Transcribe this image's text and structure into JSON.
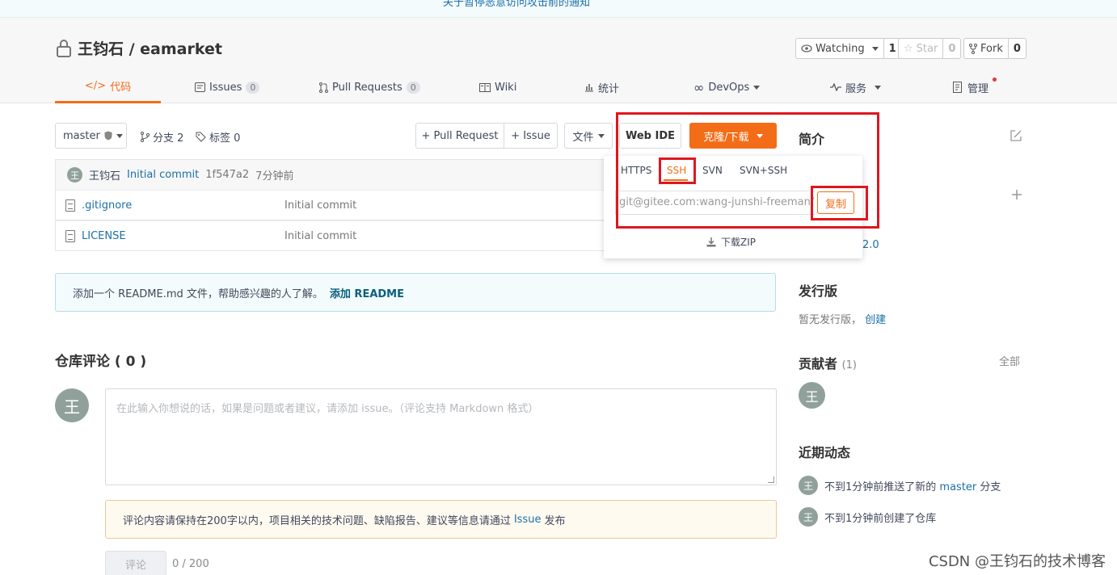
{
  "notice": "关于暂停恶意访问攻击前的通知",
  "repo": {
    "title": "王钧石 / eamarket"
  },
  "social": {
    "watch_label": "Watching",
    "watch_count": "1",
    "star_label": "Star",
    "star_count": "0",
    "fork_label": "Fork",
    "fork_count": "0"
  },
  "tabs": {
    "code": "代码",
    "issues": "Issues",
    "issues_count": "0",
    "pulls": "Pull Requests",
    "pulls_count": "0",
    "wiki": "Wiki",
    "stats": "统计",
    "devops": "DevOps",
    "services": "服务",
    "admin": "管理"
  },
  "toolbar": {
    "branch": "master",
    "branches": "分支 2",
    "tags": "标签 0",
    "pull_request": "+ Pull Request",
    "issue": "+ Issue",
    "file": "文件",
    "web_ide": "Web IDE",
    "clone": "克隆/下载"
  },
  "commit": {
    "author": "王钧石",
    "message": "Initial commit",
    "hash": "1f547a2",
    "time": "7分钟前",
    "avatar_letter": "王"
  },
  "files": [
    {
      "name": ".gitignore",
      "message": "Initial commit"
    },
    {
      "name": "LICENSE",
      "message": "Initial commit"
    }
  ],
  "readme_tip": {
    "text": "添加一个 README.md 文件，帮助感兴趣的人了解。",
    "link": "添加 README"
  },
  "comments": {
    "title": "仓库评论 ( 0 )",
    "avatar_letter": "王",
    "placeholder": "在此输入你想说的话，如果是问题或者建议，请添加 issue。（评论支持 Markdown 格式）",
    "warn_text": "评论内容请保持在200字以内，项目相关的技术问题、缺陷报告、建议等信息请通过",
    "warn_link": "Issue",
    "warn_suffix": "发布",
    "submit": "评论",
    "counter": "0 / 200"
  },
  "clone_menu": {
    "tabs": [
      "HTTPS",
      "SSH",
      "SVN",
      "SVN+SSH"
    ],
    "active": "SSH",
    "url": "git@gitee.com:wang-junshi-freeman/eamarket.git",
    "copy": "复制",
    "download_zip": "下载ZIP"
  },
  "sidebar": {
    "intro": "简介",
    "license_suffix": "2.0",
    "releases_title": "发行版",
    "releases_text": "暂无发行版，",
    "releases_create": "创建",
    "contributors_title": "贡献者",
    "contributors_count": "(1)",
    "contributors_all": "全部",
    "activity_title": "近期动态",
    "activity": [
      {
        "pre": "不到1分钟前推送了新的",
        "link": "master",
        "post": "分支"
      },
      {
        "pre": "不到1分钟前创建了仓库",
        "link": "",
        "post": ""
      }
    ],
    "avatar_letter": "王"
  },
  "watermark": "CSDN @王钧石的技术博客",
  "colors": {
    "accent": "#f36d18",
    "link": "#1b6fa8",
    "highlight_box": "#e0161e"
  }
}
